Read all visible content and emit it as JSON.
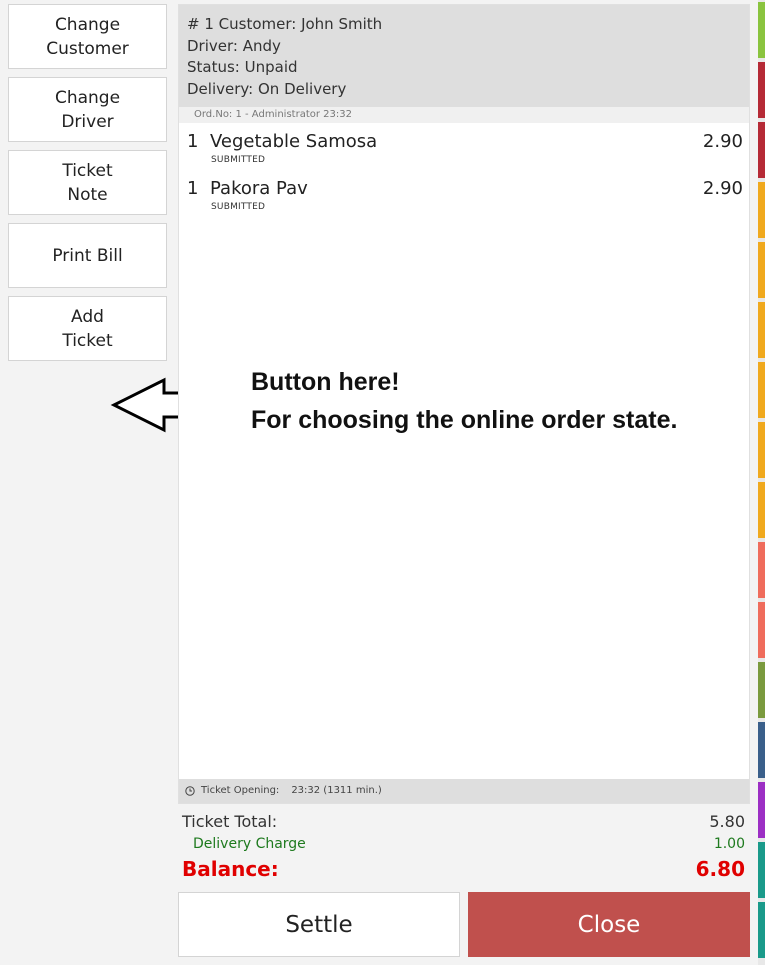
{
  "side_buttons": {
    "change_customer": "Change\nCustomer",
    "change_driver": "Change\nDriver",
    "ticket_note": "Ticket\nNote",
    "print_bill": "Print Bill",
    "add_ticket": "Add\nTicket"
  },
  "ticket": {
    "header": {
      "customer_line": "# 1 Customer: John Smith",
      "driver_line": "Driver: Andy",
      "status_line": "Status: Unpaid",
      "delivery_line": "Delivery: On Delivery"
    },
    "order_info": "Ord.No: 1 - Administrator  23:32",
    "items": [
      {
        "qty": "1",
        "name": "Vegetable Samosa",
        "price": "2.90",
        "status": "SUBMITTED"
      },
      {
        "qty": "1",
        "name": "Pakora Pav",
        "price": "2.90",
        "status": "SUBMITTED"
      }
    ],
    "footer": {
      "label": "Ticket Opening:",
      "value": "23:32 (1311 min.)"
    }
  },
  "totals": {
    "ticket_total_label": "Ticket Total:",
    "ticket_total_value": "5.80",
    "delivery_charge_label": "Delivery Charge",
    "delivery_charge_value": "1.00",
    "balance_label": "Balance:",
    "balance_value": "6.80"
  },
  "annotation": {
    "line1": "Button here!",
    "line2": "For choosing the online order state."
  },
  "actions": {
    "settle": "Settle",
    "close": "Close"
  },
  "colors": {
    "close_button": "#c0504d",
    "balance": "#e00000",
    "delivery_charge": "#1e7a1e",
    "strip": [
      "#8ac43f",
      "#b52a36",
      "#b52a36",
      "#f0a91e",
      "#f0a91e",
      "#f0a91e",
      "#f0a91e",
      "#f0a91e",
      "#f0a91e",
      "#ef6c5c",
      "#ef6c5c",
      "#7a9a3e",
      "#3a5f8a",
      "#9c2fc4",
      "#1a9a8a",
      "#1a9a8a"
    ]
  }
}
